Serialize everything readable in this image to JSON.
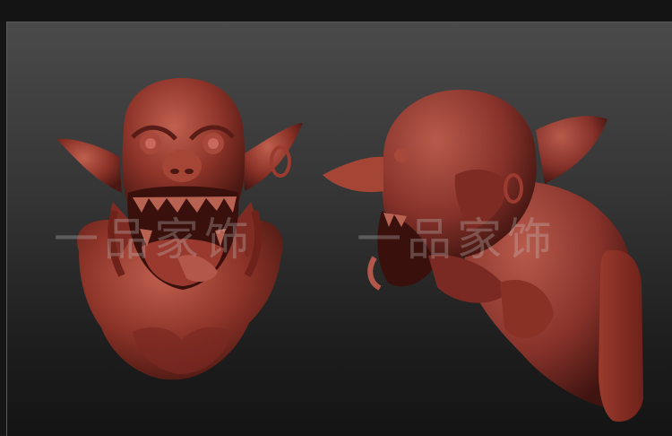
{
  "watermarks": [
    {
      "text": "一品家饰"
    },
    {
      "text": "一品家饰"
    }
  ],
  "colors": {
    "clay": "#8e3429",
    "clay_light": "#b5564a",
    "clay_dark": "#5a1c16",
    "viewport_top": "#4a4a4a",
    "viewport_bottom": "#141414"
  },
  "objects": [
    {
      "name": "goblin-bust-front"
    },
    {
      "name": "goblin-bust-side"
    }
  ]
}
